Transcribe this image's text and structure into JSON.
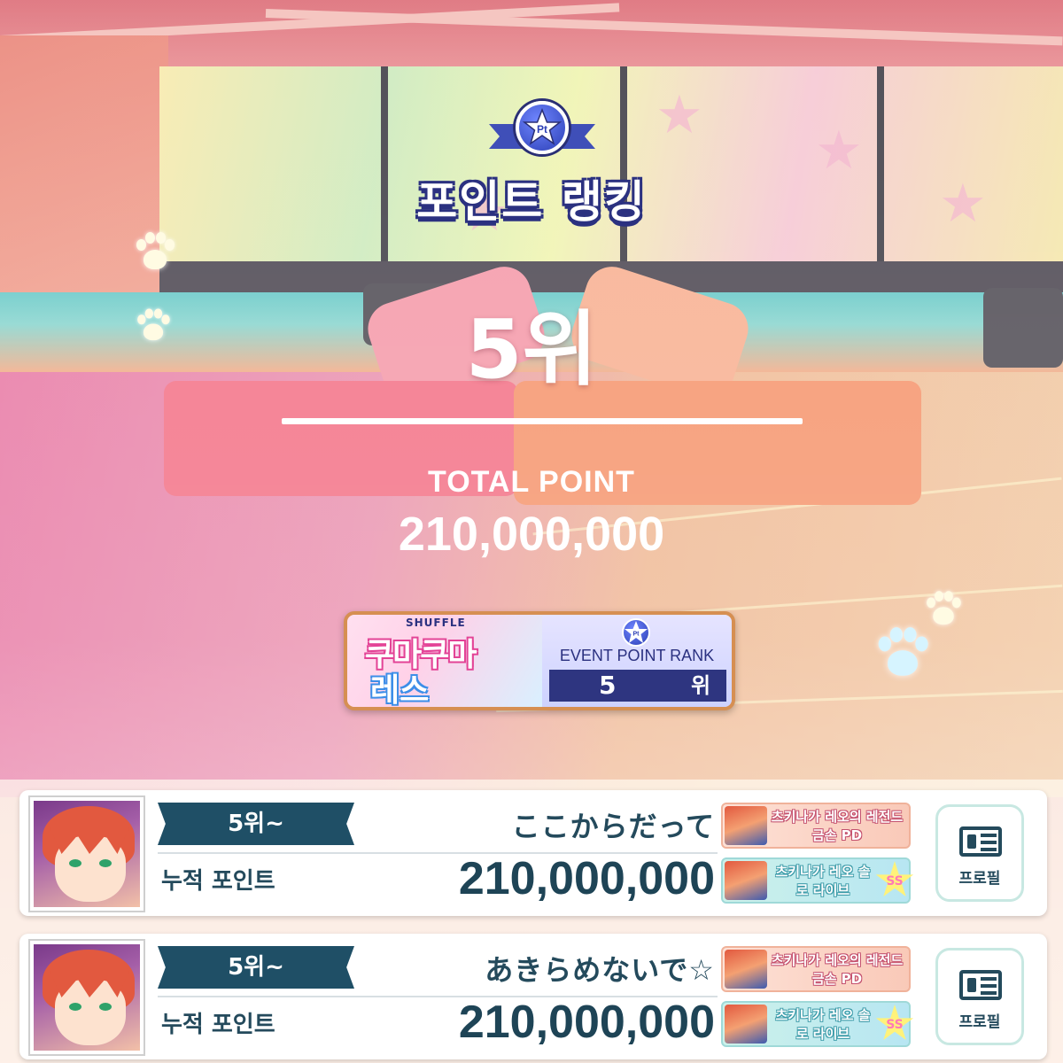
{
  "header": {
    "medal_text": "Pt",
    "title": "포인트 랭킹",
    "rank": "5위",
    "total_label": "TOTAL POINT",
    "total_value": "210,000,000"
  },
  "event_badge": {
    "logo_small": "SHUFFLE",
    "logo_line1": "쿠마쿠마",
    "logo_line2": "레스",
    "medal_text": "Pt",
    "label": "EVENT POINT RANK",
    "rank_number": "5",
    "rank_unit": "위"
  },
  "rows": [
    {
      "rank_tag": "5위~",
      "message": "ここからだって",
      "points_label": "누적 포인트",
      "points": "210,000,000",
      "card1": "츠키나가 레오의 레전드 금손 PD",
      "card2": "츠키나가 레오 솔로 라이브",
      "card2_badge": "SS",
      "profile_label": "프로필"
    },
    {
      "rank_tag": "5위~",
      "message": "あきらめないで☆",
      "points_label": "누적 포인트",
      "points": "210,000,000",
      "card1": "츠키나가 레오의 레전드 금손 PD",
      "card2": "츠키나가 레오 솔로 라이브",
      "card2_badge": "SS",
      "profile_label": "프로필"
    }
  ],
  "colors": {
    "title_outline": "#2b3180",
    "rank_tag_bg": "#1f4f66",
    "row_text": "#244a5c"
  }
}
